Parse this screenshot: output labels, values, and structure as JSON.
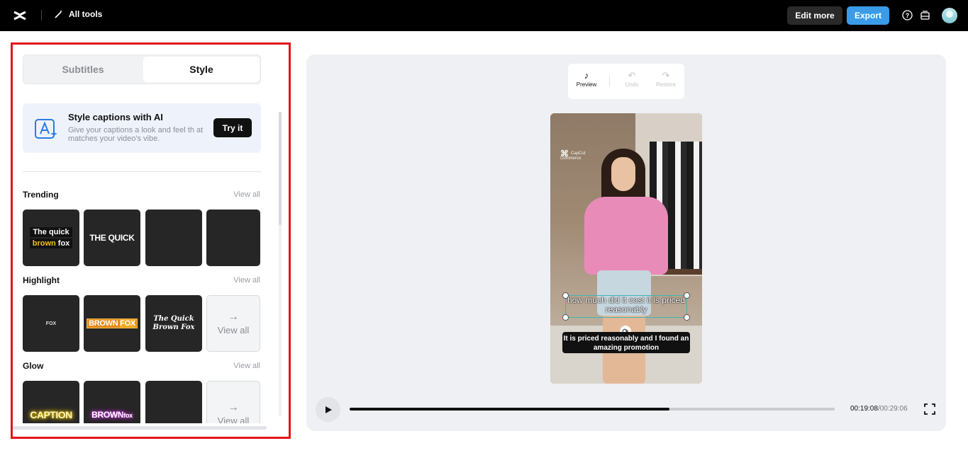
{
  "topbar": {
    "all_tools_label": "All tools",
    "edit_more_label": "Edit more",
    "export_label": "Export",
    "colors": {
      "bar": "#000000",
      "export": "#3b9be8"
    }
  },
  "panel": {
    "tabs": [
      "Subtitles",
      "Style"
    ],
    "active_tab": "Style",
    "ai_card": {
      "title": "Style captions with AI",
      "description": "Give your captions a look and feel th at matches your video's vibe.",
      "button": "Try it"
    },
    "sections": [
      {
        "title": "Trending",
        "view_all": "View all",
        "thumbs": [
          {
            "line1": "The quick",
            "line2a": "brown",
            "line2b": " fox"
          },
          {
            "text": "THE QUICK"
          },
          {
            "text": ""
          },
          {
            "text": ""
          }
        ]
      },
      {
        "title": "Highlight",
        "view_all": "View all",
        "thumbs": [
          {
            "text": "FOX"
          },
          {
            "text_a": "BROWN",
            "text_b": "FOX"
          },
          {
            "line1": "The Quick",
            "line2": "Brown Fox"
          }
        ],
        "view_all_tile": "View all"
      },
      {
        "title": "Glow",
        "view_all": "View all",
        "thumbs": [
          {
            "text": "CAPTION"
          },
          {
            "text_a": "BROWN",
            "text_b": "fox"
          },
          {
            "text": ""
          }
        ],
        "view_all_tile": "View all"
      }
    ],
    "highlight_color": "#e0151a"
  },
  "preview": {
    "toolbar": {
      "preview": "Preview",
      "undo": "Undo",
      "restore": "Restore"
    },
    "watermark": {
      "line1": "CapCut",
      "line2": "Commerce"
    },
    "subtitle_selected": "how much did it cost it is priced reasonably",
    "caption": "It is priced reasonably and I found an amazing promotion",
    "time_current": "00:19:08",
    "time_total": "/00:29:06",
    "progress": 0.66
  }
}
